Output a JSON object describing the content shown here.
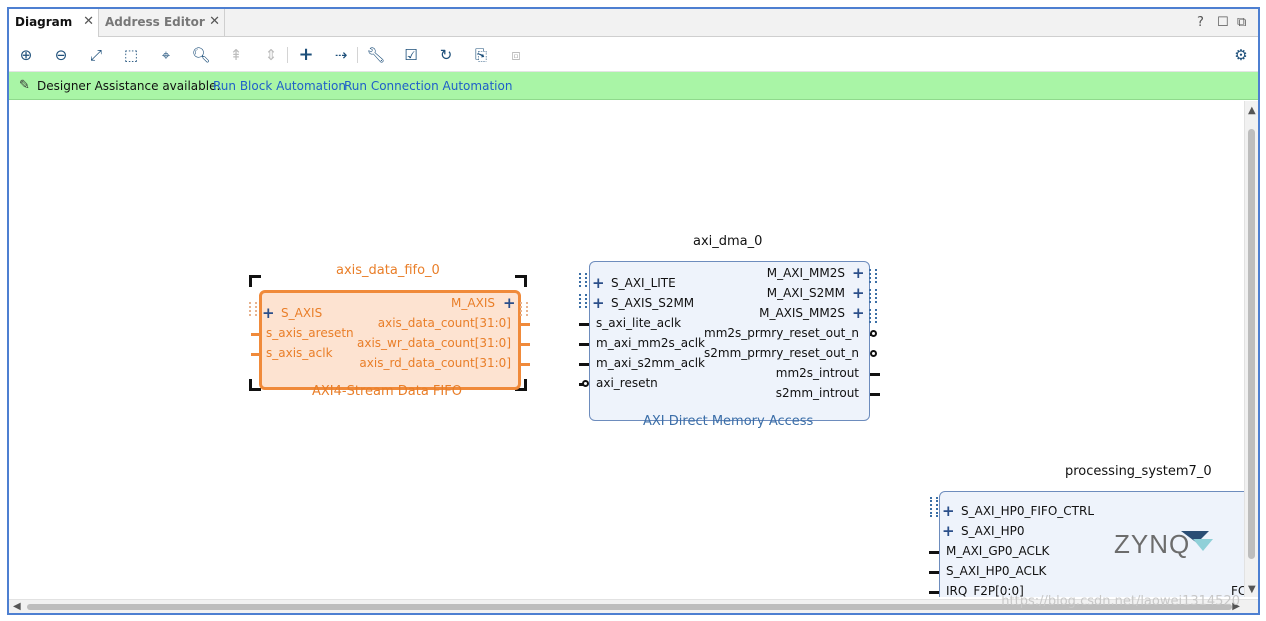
{
  "tabs": [
    {
      "label": "Diagram",
      "active": true
    },
    {
      "label": "Address Editor",
      "active": false
    }
  ],
  "window_controls": {
    "help": "?",
    "restore": "☐",
    "detach": "⧉"
  },
  "assistance": {
    "text": "Designer Assistance available.",
    "link_block": "Run Block Automation",
    "link_connection": "Run Connection Automation"
  },
  "fifo": {
    "instance": "axis_data_fifo_0",
    "type_label": "AXI4-Stream Data FIFO",
    "inputs": [
      "S_AXIS",
      "s_axis_aresetn",
      "s_axis_aclk"
    ],
    "outputs": [
      "M_AXIS",
      "axis_data_count[31:0]",
      "axis_wr_data_count[31:0]",
      "axis_rd_data_count[31:0]"
    ]
  },
  "dma": {
    "instance": "axi_dma_0",
    "type_label": "AXI Direct Memory Access",
    "inputs": [
      "S_AXI_LITE",
      "S_AXIS_S2MM",
      "s_axi_lite_aclk",
      "m_axi_mm2s_aclk",
      "m_axi_s2mm_aclk",
      "axi_resetn"
    ],
    "outputs": [
      "M_AXI_MM2S",
      "M_AXI_S2MM",
      "M_AXIS_MM2S",
      "mm2s_prmry_reset_out_n",
      "s2mm_prmry_reset_out_n",
      "mm2s_introut",
      "s2mm_introut"
    ]
  },
  "ps": {
    "instance": "processing_system7_0",
    "logo": "ZYNQ",
    "inputs": [
      "S_AXI_HP0_FIFO_CTRL",
      "S_AXI_HP0",
      "M_AXI_GP0_ACLK",
      "S_AXI_HP0_ACLK",
      "IRQ_F2P[0:0]"
    ],
    "right_partial": "FC"
  },
  "watermark": "https://blog.csdn.net/laowei1314520",
  "colors": {
    "frame": "#4d7fd1",
    "assist_bg": "#a9f5a6",
    "fifo_border": "#f08a3a",
    "fifo_fill": "#fde3d1",
    "ip_fill": "#eef3fb",
    "link": "#1f5fc9"
  }
}
